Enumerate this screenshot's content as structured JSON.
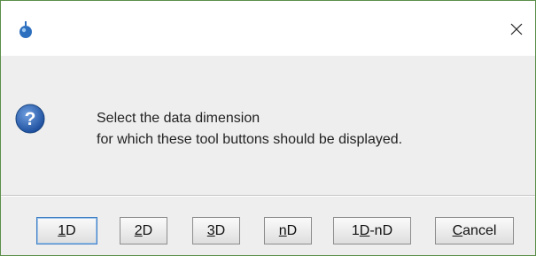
{
  "dialog": {
    "close_glyph": "×",
    "app_icon": "app-logo-icon",
    "message_icon": "question-icon",
    "message_line1": "Select the data dimension",
    "message_line2": "for which these tool buttons should be displayed."
  },
  "buttons": [
    {
      "mnemonic": "1",
      "rest": "D"
    },
    {
      "mnemonic": "2",
      "rest": "D"
    },
    {
      "mnemonic": "3",
      "rest": "D"
    },
    {
      "mnemonic": "n",
      "rest": "D"
    },
    {
      "pre": "1",
      "mnemonic": "D",
      "rest": "-nD"
    },
    {
      "mnemonic": "C",
      "rest": "ancel"
    }
  ],
  "colors": {
    "window_border": "#5b8f49",
    "dialog_bg": "#eeeeee",
    "default_button_border": "#3f7fc6",
    "question_icon": "#2f64b3"
  }
}
